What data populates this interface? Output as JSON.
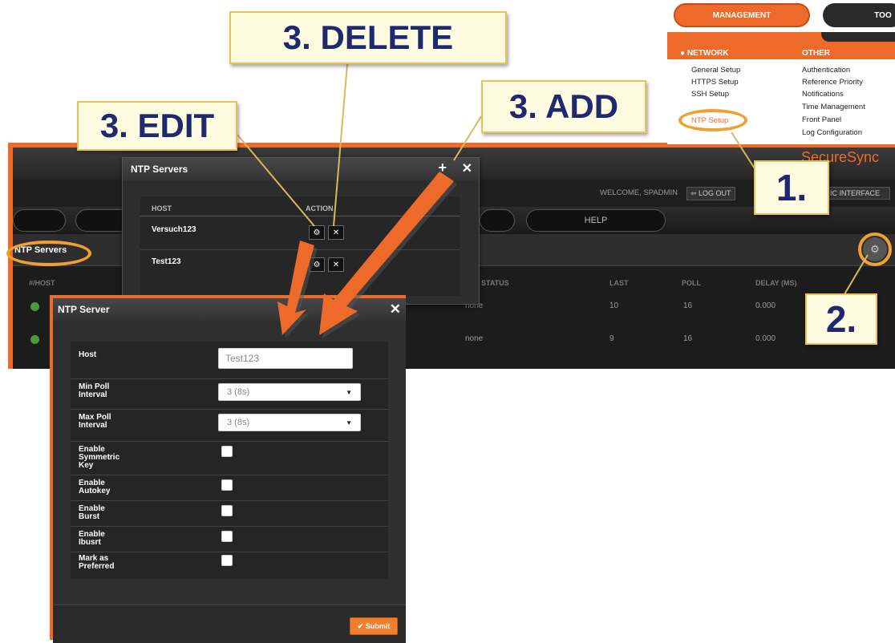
{
  "menu": {
    "tab_management": "MANAGEMENT",
    "tab_tools": "TOO",
    "network_title": "● NETWORK",
    "other_title": "OTHER",
    "network_items": [
      "General Setup",
      "HTTPS Setup",
      "SSH Setup",
      "NTP Setup"
    ],
    "other_items": [
      "Authentication",
      "Reference Priority",
      "Notifications",
      "Time Management",
      "Front Panel",
      "Log Configuration"
    ]
  },
  "app": {
    "logo": "SecureSync",
    "welcome": "WELCOME, SPADMIN",
    "logout": "⇦ LOG OUT",
    "interface": "IC INTERFACE",
    "help": "HELP",
    "page_title": "NTP Servers",
    "table_headers": [
      "#/HOST",
      "STATUS",
      "LAST",
      "POLL",
      "DELAY (MS)"
    ],
    "rows": [
      {
        "status": "none",
        "last": "10",
        "poll": "16",
        "delay": "0.000"
      },
      {
        "status": "none",
        "last": "9",
        "poll": "16",
        "delay": "0.000"
      }
    ]
  },
  "ntp_servers_dialog": {
    "title": "NTP Servers",
    "col_host": "HOST",
    "col_action": "ACTION",
    "hosts": [
      "Versuch123",
      "Test123"
    ],
    "add_icon": "+",
    "close_icon": "✕"
  },
  "ntp_server_dialog": {
    "title": "NTP Server",
    "close_icon": "✕",
    "fields": {
      "host_label": "Host",
      "host_value": "Test123",
      "min_poll_label": "Min Poll Interval",
      "min_poll_value": "3 (8s)",
      "max_poll_label": "Max Poll Interval",
      "max_poll_value": "3 (8s)",
      "sym_key_label": "Enable Symmetric Key",
      "autokey_label": "Enable Autokey",
      "burst_label": "Enable Burst",
      "iburst_label": "Enable Ibusrt",
      "preferred_label": "Mark as Preferred"
    },
    "submit": "✔ Submit"
  },
  "callouts": {
    "delete": "3. DELETE",
    "edit": "3. EDIT",
    "add": "3. ADD",
    "step1": "1.",
    "step2": "2."
  },
  "colors": {
    "accent": "#ee6a2a",
    "callout_text": "#1f2a6e",
    "callout_bg": "#fffbe0",
    "arrow": "#ee6a2a"
  }
}
